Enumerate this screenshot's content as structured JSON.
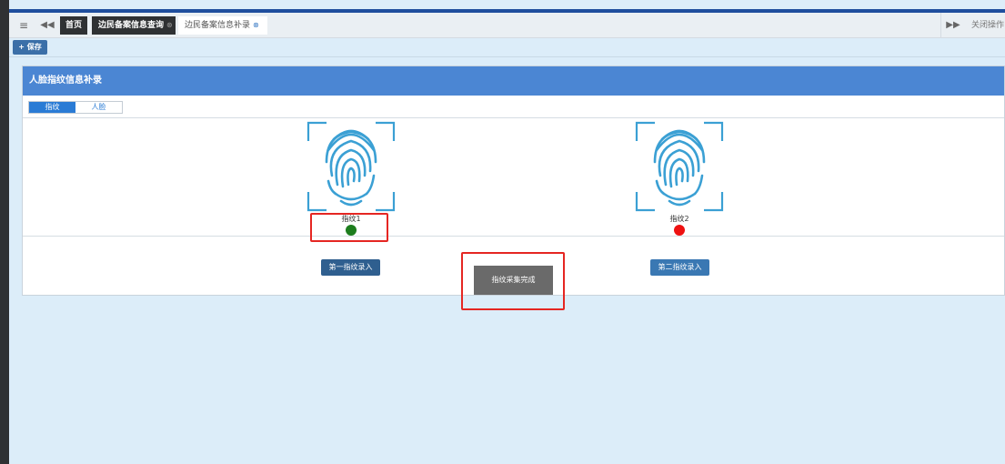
{
  "tabbar": {
    "menu_icon": "menu-icon",
    "prev_icon": "double-left-arrow-icon",
    "tabs": [
      {
        "label": "首页",
        "active": false
      },
      {
        "label": "边民备案信息查询",
        "active": false,
        "closable": true
      },
      {
        "label": "边民备案信息补录",
        "active": true,
        "closable": true
      }
    ],
    "next_icon": "double-right-arrow-icon",
    "close_ops_label": "关闭操作"
  },
  "toolbar": {
    "save_label": "+ 保存"
  },
  "panel": {
    "title": "人脸指纹信息补录",
    "subtabs": [
      {
        "label": "指纹",
        "active": true
      },
      {
        "label": "人脸",
        "active": false
      }
    ],
    "fingerprints": [
      {
        "label": "指纹1",
        "status": "captured",
        "status_color": "#1d7d1d"
      },
      {
        "label": "指纹2",
        "status": "not-captured",
        "status_color": "#ee1111"
      }
    ],
    "buttons": {
      "first_label": "第一指纹录入",
      "second_label": "第二指纹录入"
    }
  },
  "complete_button_label": "指纹采集完成",
  "colors": {
    "header_blue": "#4b86d3",
    "page_bg": "#dcedf9",
    "highlight_red": "#e52622"
  }
}
